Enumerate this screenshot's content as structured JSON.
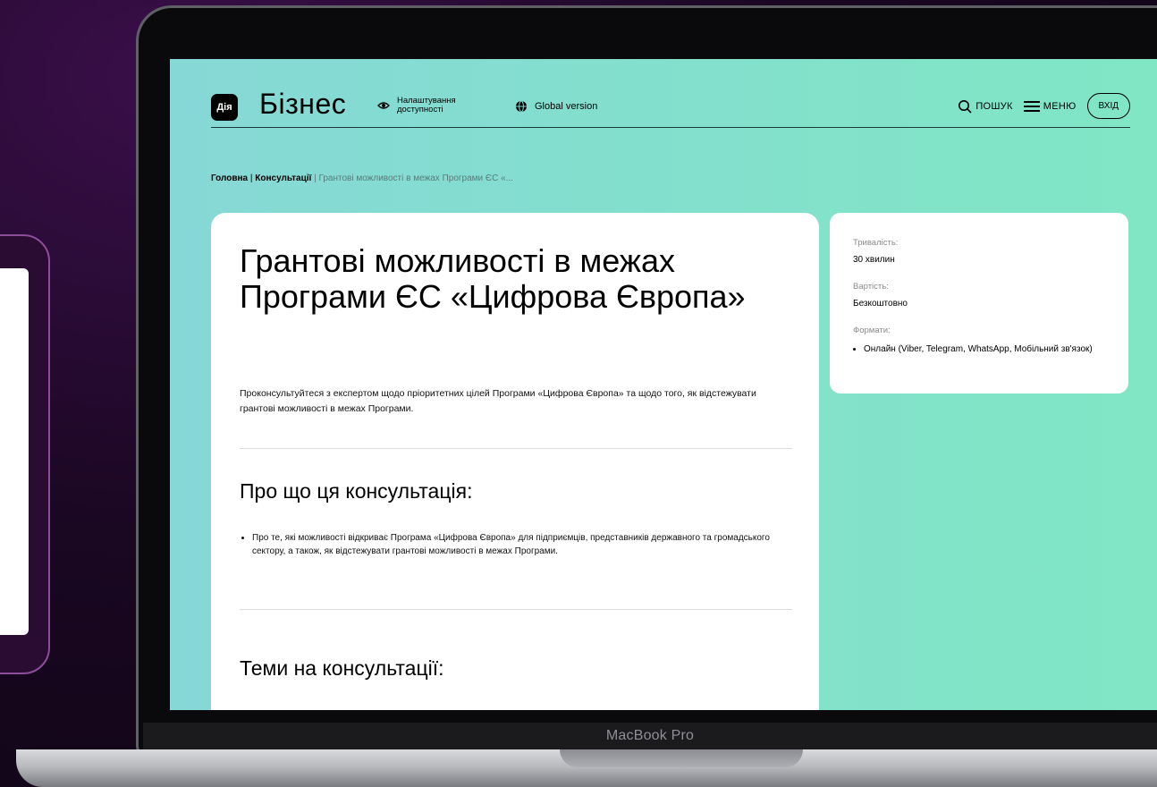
{
  "header": {
    "logo_text": "Дія",
    "brand": "Бізнес",
    "accessibility_label": "Налаштування доступності",
    "global_version": "Global version",
    "search_label": "ПОШУК",
    "menu_label": "МЕНЮ",
    "login_label": "ВХІД"
  },
  "breadcrumbs": {
    "home": "Головна",
    "separator": "|",
    "consultations": "Консультації",
    "current": "Грантові можливості в межах Програми ЄС «..."
  },
  "main": {
    "title": "Грантові можливості в межах Програми ЄС «Цифрова Європа»",
    "intro": "Проконсультуйтеся з експертом щодо пріоритетних цілей Програми «Цифрова Європа» та щодо того, як відстежувати грантові можливості в межах Програми.",
    "about_heading": "Про що ця консультація:",
    "about_items": [
      "Про те, які можливості відкриває Програма «Цифрова Європа» для підприємців, представників державного та громадського сектору, а також, як відстежувати грантові можливості в межах Програми."
    ],
    "topics_heading": "Теми на консультації:"
  },
  "sidebar": {
    "duration_label": "Тривалість:",
    "duration_value": "30 хвилин",
    "cost_label": "Вартість:",
    "cost_value": "Безкоштовно",
    "formats_label": "Формати:",
    "formats": [
      "Онлайн (Viber, Telegram, WhatsApp, Мобільний зв'язок)"
    ]
  },
  "device": {
    "model_label": "MacBook Pro"
  },
  "colors": {
    "screen_bg_left": "#86d8d6",
    "screen_bg_right": "#80e6c4",
    "card_bg": "#ffffff",
    "background": "#1a0722"
  },
  "icons": {
    "accessibility": "eye-icon",
    "globe": "globe-icon",
    "search": "search-icon",
    "menu": "hamburger-menu-icon"
  }
}
